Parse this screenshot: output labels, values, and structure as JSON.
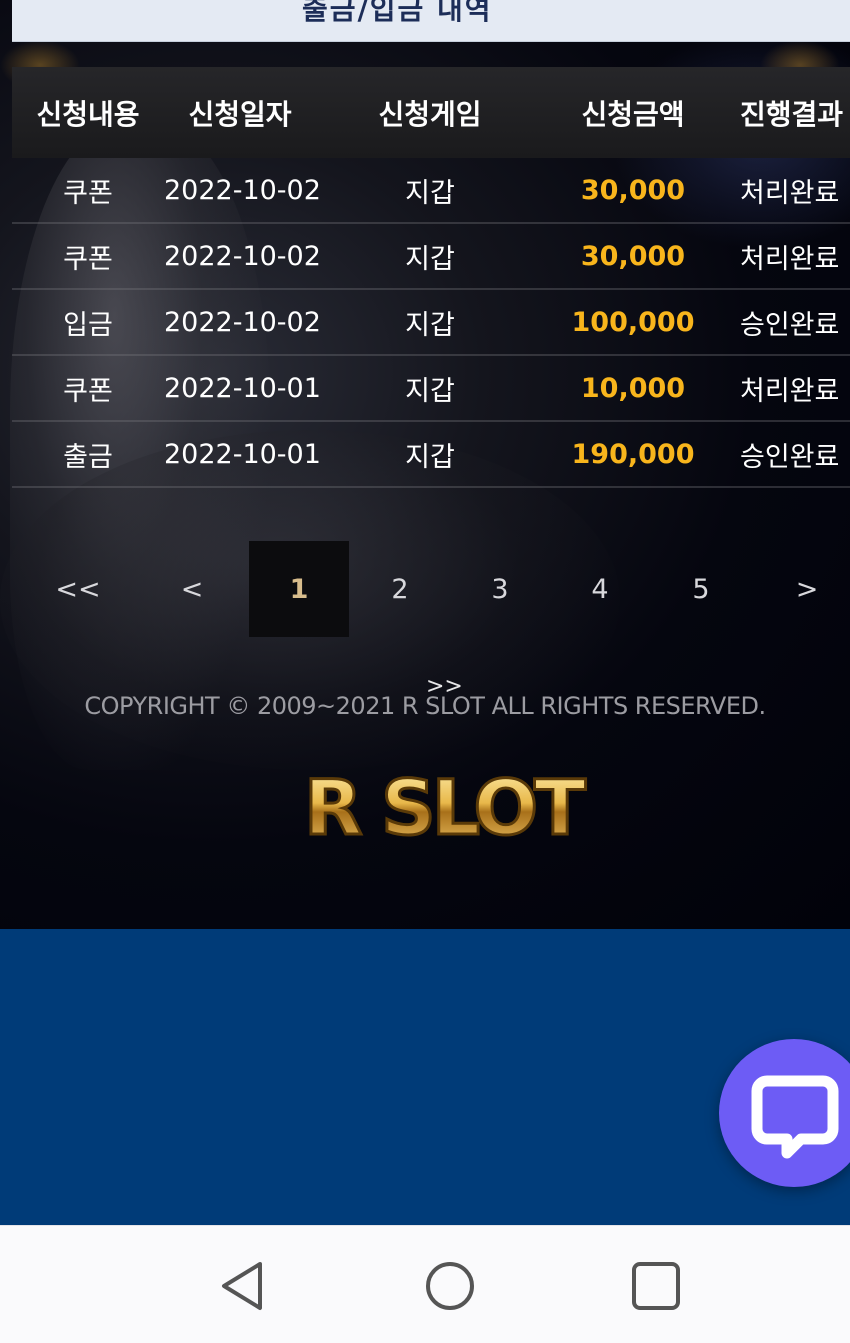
{
  "header": {
    "cut_title": "출금/입금 내역"
  },
  "table": {
    "columns": [
      "신청내용",
      "신청일자",
      "신청게임",
      "신청금액",
      "진행결과"
    ],
    "rows": [
      {
        "type": "쿠폰",
        "date": "2022-10-02",
        "game": "지갑",
        "amount": "30,000",
        "result": "처리완료"
      },
      {
        "type": "쿠폰",
        "date": "2022-10-02",
        "game": "지갑",
        "amount": "30,000",
        "result": "처리완료"
      },
      {
        "type": "입금",
        "date": "2022-10-02",
        "game": "지갑",
        "amount": "100,000",
        "result": "승인완료"
      },
      {
        "type": "쿠폰",
        "date": "2022-10-01",
        "game": "지갑",
        "amount": "10,000",
        "result": "처리완료"
      },
      {
        "type": "출금",
        "date": "2022-10-01",
        "game": "지갑",
        "amount": "190,000",
        "result": "승인완료"
      }
    ]
  },
  "pagination": {
    "first": "<<",
    "prev": "<",
    "pages": [
      "1",
      "2",
      "3",
      "4",
      "5"
    ],
    "current": "1",
    "next": ">",
    "last": ">>"
  },
  "footer": {
    "copyright": "COPYRIGHT © 2009~2021 R SLOT ALL RIGHTS RESERVED.",
    "logo_text": "R SLOT"
  },
  "colors": {
    "amount": "#f8b51c",
    "page_bg_blue": "#003b78",
    "chat_button": "#6d5cf5",
    "logo_gold": "#e8b84a"
  },
  "icons": {
    "chat": "chat-bubble-icon",
    "back": "triangle-back-icon",
    "home": "circle-home-icon",
    "recents": "square-recents-icon"
  }
}
